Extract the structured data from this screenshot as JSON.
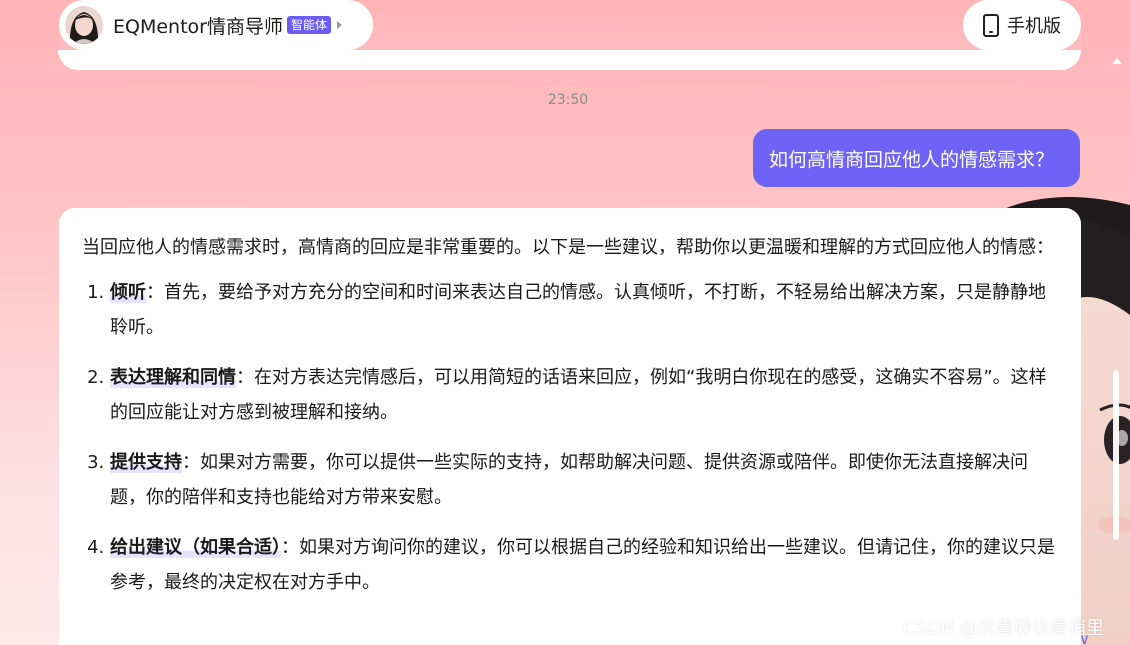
{
  "header": {
    "agent_name": "EQMentor情商导师",
    "agent_badge": "智能体",
    "mobile_label": "手机版"
  },
  "chat": {
    "timestamp": "23:50",
    "user_message": "如何高情商回应他人的情感需求？",
    "answer": {
      "intro": "当回应他人的情感需求时，高情商的回应是非常重要的。以下是一些建议，帮助你以更温暖和理解的方式回应他人的情感：",
      "items": [
        {
          "keyword": "倾听",
          "text": "：首先，要给予对方充分的空间和时间来表达自己的情感。认真倾听，不打断，不轻易给出解决方案，只是静静地聆听。"
        },
        {
          "keyword": "表达理解和同情",
          "text": "：在对方表达完情感后，可以用简短的话语来回应，例如“我明白你现在的感受，这确实不容易”。这样的回应能让对方感到被理解和接纳。"
        },
        {
          "keyword": "提供支持",
          "text": "：如果对方需要，你可以提供一些实际的支持，如帮助解决问题、提供资源或陪伴。即使你无法直接解决问题，你的陪伴和支持也能给对方带来安慰。"
        },
        {
          "keyword": "给出建议（如果合适）",
          "text": "：如果对方询问你的建议，你可以根据自己的经验和知识给出一些建议。但请记住，你的建议只是参考，最终的决定权在对方手中。"
        }
      ]
    }
  },
  "watermark": "CSDN @欢喜躲在眉梢里",
  "colors": {
    "accent": "#6e62f7",
    "badge": "#6b5cf6",
    "background_top": "#ffb3b6",
    "background_bottom": "#ffe8ea"
  },
  "icons": {
    "mobile": "phone-icon",
    "caret": "chevron-right-icon",
    "scroll_down": "chevron-down-icon"
  }
}
